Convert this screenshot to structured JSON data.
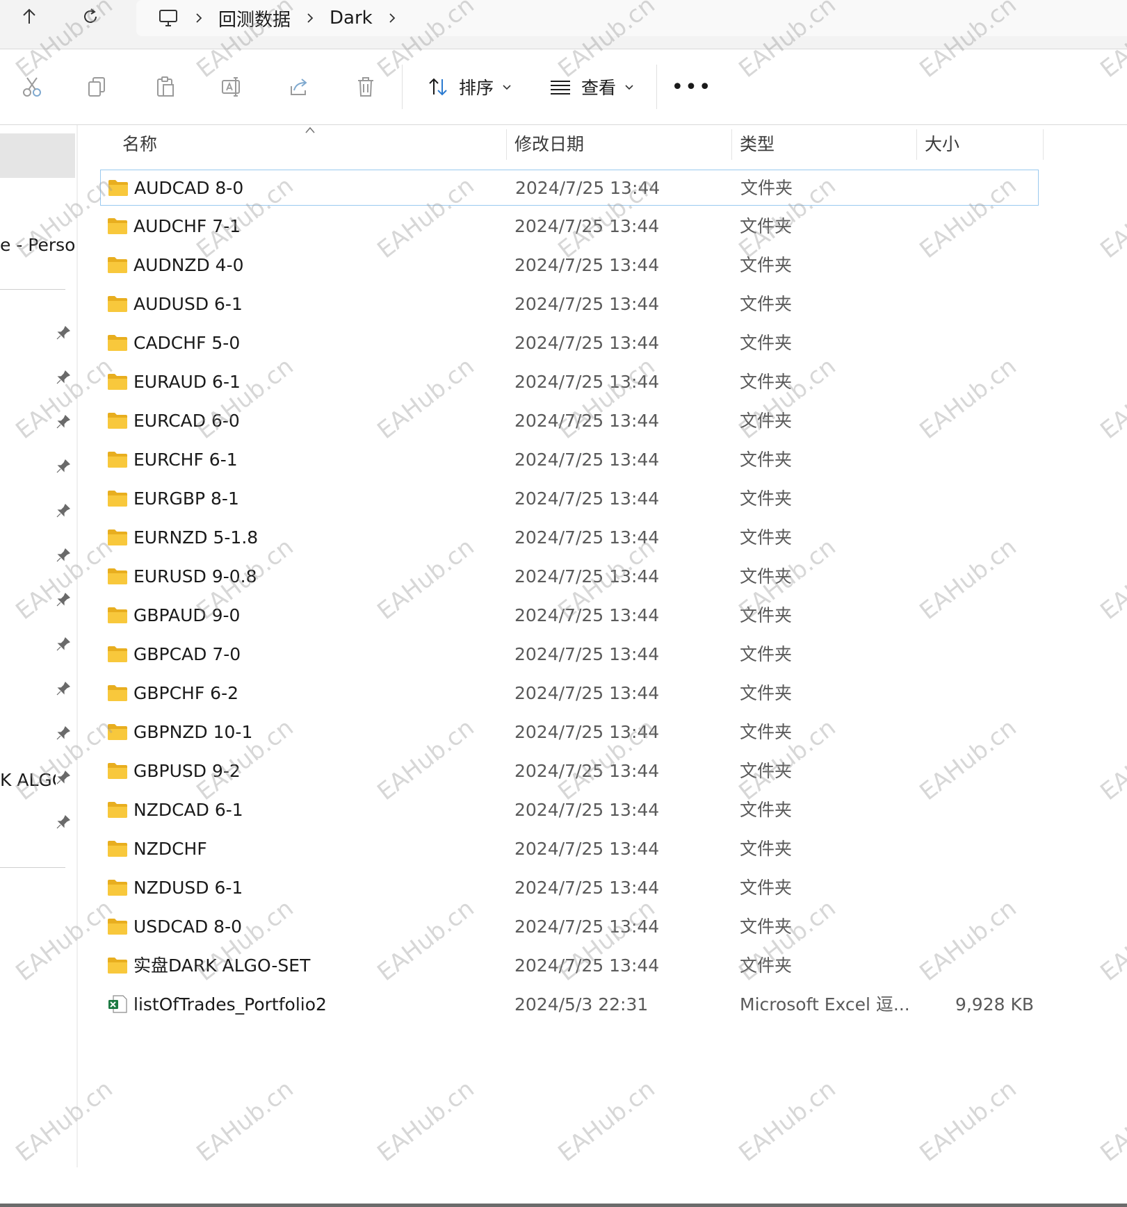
{
  "address_bar": {
    "crumbs": [
      "回测数据",
      "Dark"
    ],
    "icons": [
      "up-arrow-icon",
      "refresh-icon",
      "computer-icon",
      "chevron-right-icon"
    ]
  },
  "toolbar": {
    "sort_label": "排序",
    "view_label": "查看",
    "more_label": "•••",
    "icons": [
      "cut-icon",
      "copy-icon",
      "paste-icon",
      "rename-icon",
      "share-icon",
      "delete-icon",
      "sort-icon",
      "view-icon",
      "more-icon"
    ]
  },
  "nav_pane": {
    "item_onedrive": "e - Persor",
    "item_algo": "K ALGO",
    "icons": [
      "pin-icon"
    ]
  },
  "columns": {
    "name": "名称",
    "modified": "修改日期",
    "type": "类型",
    "size": "大小"
  },
  "files": [
    {
      "name": "AUDCAD 8-0",
      "modified": "2024/7/25 13:44",
      "type": "文件夹",
      "size": "",
      "icon": "folder-icon"
    },
    {
      "name": "AUDCHF 7-1",
      "modified": "2024/7/25 13:44",
      "type": "文件夹",
      "size": "",
      "icon": "folder-icon"
    },
    {
      "name": "AUDNZD 4-0",
      "modified": "2024/7/25 13:44",
      "type": "文件夹",
      "size": "",
      "icon": "folder-icon"
    },
    {
      "name": "AUDUSD 6-1",
      "modified": "2024/7/25 13:44",
      "type": "文件夹",
      "size": "",
      "icon": "folder-icon"
    },
    {
      "name": "CADCHF 5-0",
      "modified": "2024/7/25 13:44",
      "type": "文件夹",
      "size": "",
      "icon": "folder-icon"
    },
    {
      "name": "EURAUD 6-1",
      "modified": "2024/7/25 13:44",
      "type": "文件夹",
      "size": "",
      "icon": "folder-icon"
    },
    {
      "name": "EURCAD 6-0",
      "modified": "2024/7/25 13:44",
      "type": "文件夹",
      "size": "",
      "icon": "folder-icon"
    },
    {
      "name": "EURCHF 6-1",
      "modified": "2024/7/25 13:44",
      "type": "文件夹",
      "size": "",
      "icon": "folder-icon"
    },
    {
      "name": "EURGBP 8-1",
      "modified": "2024/7/25 13:44",
      "type": "文件夹",
      "size": "",
      "icon": "folder-icon"
    },
    {
      "name": "EURNZD 5-1.8",
      "modified": "2024/7/25 13:44",
      "type": "文件夹",
      "size": "",
      "icon": "folder-icon"
    },
    {
      "name": "EURUSD 9-0.8",
      "modified": "2024/7/25 13:44",
      "type": "文件夹",
      "size": "",
      "icon": "folder-icon"
    },
    {
      "name": "GBPAUD 9-0",
      "modified": "2024/7/25 13:44",
      "type": "文件夹",
      "size": "",
      "icon": "folder-icon"
    },
    {
      "name": "GBPCAD 7-0",
      "modified": "2024/7/25 13:44",
      "type": "文件夹",
      "size": "",
      "icon": "folder-icon"
    },
    {
      "name": "GBPCHF 6-2",
      "modified": "2024/7/25 13:44",
      "type": "文件夹",
      "size": "",
      "icon": "folder-icon"
    },
    {
      "name": "GBPNZD 10-1",
      "modified": "2024/7/25 13:44",
      "type": "文件夹",
      "size": "",
      "icon": "folder-icon"
    },
    {
      "name": "GBPUSD 9-2",
      "modified": "2024/7/25 13:44",
      "type": "文件夹",
      "size": "",
      "icon": "folder-icon"
    },
    {
      "name": "NZDCAD 6-1",
      "modified": "2024/7/25 13:44",
      "type": "文件夹",
      "size": "",
      "icon": "folder-icon"
    },
    {
      "name": "NZDCHF",
      "modified": "2024/7/25 13:44",
      "type": "文件夹",
      "size": "",
      "icon": "folder-icon"
    },
    {
      "name": "NZDUSD 6-1",
      "modified": "2024/7/25 13:44",
      "type": "文件夹",
      "size": "",
      "icon": "folder-icon"
    },
    {
      "name": "USDCAD 8-0",
      "modified": "2024/7/25 13:44",
      "type": "文件夹",
      "size": "",
      "icon": "folder-icon"
    },
    {
      "name": "实盘DARK ALGO-SET",
      "modified": "2024/7/25 13:44",
      "type": "文件夹",
      "size": "",
      "icon": "folder-icon"
    },
    {
      "name": "listOfTrades_Portfolio2",
      "modified": "2024/5/3 22:31",
      "type": "Microsoft Excel 逗...",
      "size": "9,928 KB",
      "icon": "excel-file-icon"
    }
  ],
  "selected_row": 0,
  "watermark": "EAHub.cn",
  "colors": {
    "folder": "#F8C83C",
    "selection_border": "#99C9EF",
    "nav_selected": "#E5E5E5",
    "excel_green": "#1D7A43"
  }
}
